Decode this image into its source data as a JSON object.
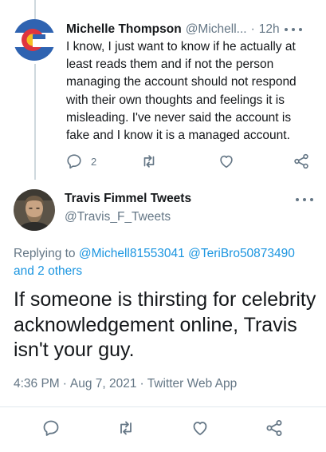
{
  "reply": {
    "name": "Michelle Thompson",
    "handle": "@Michell...",
    "separator": "·",
    "time": "12h",
    "text": "I know, I just want to know if he actually at least reads them and if not the person managing the account should not respond with their own thoughts and feelings it is misleading. I've never said the account is fake and I know it is a managed account.",
    "reply_count": "2",
    "avatar_icon": "colorado-flag-avatar",
    "colors": {
      "flag_red": "#e0353e",
      "flag_gold": "#f4c024",
      "flag_blue": "#2f63b1"
    }
  },
  "main": {
    "name": "Travis Fimmel Tweets",
    "handle": "@Travis_F_Tweets",
    "replying_prefix": "Replying to",
    "mention_1": "@Michell81553041",
    "mention_2": "@TeriBro50873490",
    "and_others": "and 2 others",
    "text": "If someone is thirsting for celebrity acknowledgement online, Travis isn't your guy.",
    "time": "4:36 PM",
    "date": "Aug 7, 2021",
    "separator": "·",
    "source": "Twitter Web App",
    "avatar_icon": "profile-photo-avatar"
  },
  "colors": {
    "link": "#1b95e0",
    "muted": "#657786",
    "text": "#14171a",
    "divider": "#e1e8ed"
  }
}
